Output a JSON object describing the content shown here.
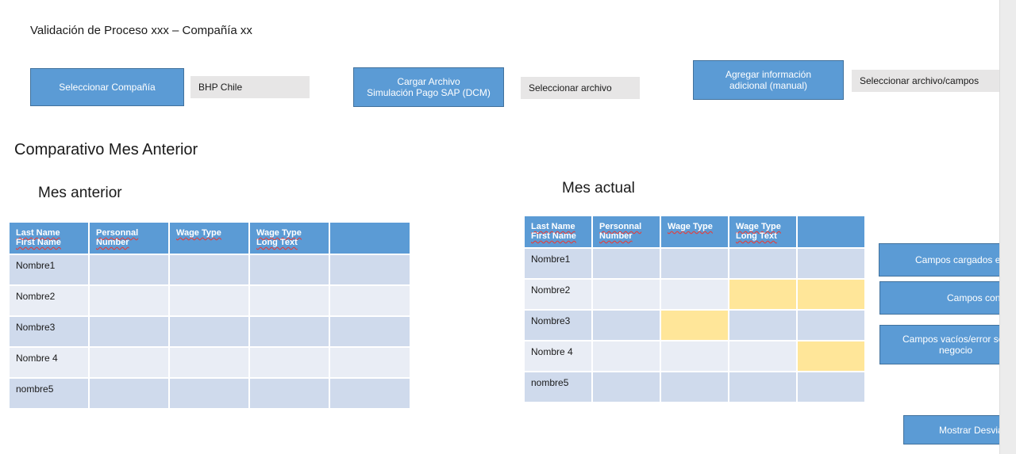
{
  "page": {
    "title": "Validación de Proceso xxx – Compañía xx"
  },
  "controls": {
    "select_company_label": "Seleccionar Compañía",
    "company_value": "BHP Chile",
    "load_file_label": "Cargar Archivo\nSimulación Pago SAP (DCM)",
    "file_value": "Seleccionar archivo",
    "add_info_label": "Agregar información\nadicional (manual)",
    "add_info_value": "Seleccionar archivo/campos"
  },
  "comparison": {
    "title": "Comparativo Mes Anterior",
    "previous": {
      "title": "Mes anterior",
      "headers": [
        [
          "Last Name",
          "First Name"
        ],
        [
          "Personnal",
          "Number"
        ],
        [
          "Wage Type"
        ],
        [
          "Wage Type",
          "Long Text"
        ],
        [
          ""
        ]
      ],
      "rows": [
        [
          "Nombre1",
          "",
          "",
          "",
          ""
        ],
        [
          "Nombre2",
          "",
          "",
          "",
          ""
        ],
        [
          "Nombre3",
          "",
          "",
          "",
          ""
        ],
        [
          "Nombre 4",
          "",
          "",
          "",
          ""
        ],
        [
          "nombre5",
          "",
          "",
          "",
          ""
        ]
      ]
    },
    "current": {
      "title": "Mes actual",
      "headers": [
        [
          "Last Name",
          "First Name"
        ],
        [
          "Personnal",
          "Number"
        ],
        [
          "Wage Type"
        ],
        [
          "Wage Type",
          "Long Text"
        ],
        [
          ""
        ]
      ],
      "rows": [
        [
          "Nombre1",
          "",
          "",
          "",
          ""
        ],
        [
          "Nombre2",
          "",
          "",
          "",
          ""
        ],
        [
          "Nombre3",
          "",
          "",
          "",
          ""
        ],
        [
          "Nombre 4",
          "",
          "",
          "",
          ""
        ],
        [
          "nombre5",
          "",
          "",
          "",
          ""
        ]
      ],
      "highlights": [
        [
          1,
          3
        ],
        [
          1,
          4
        ],
        [
          2,
          2
        ],
        [
          3,
          4
        ]
      ]
    }
  },
  "legend": {
    "loaded_ok": "Campos cargados exit",
    "with_error": "Campos con er",
    "empty_error": "Campos vacíos/error seg\nnegocio"
  },
  "actions": {
    "show_deviations": "Mostrar Desviac"
  },
  "colors": {
    "accent": "#5b9bd5",
    "row_odd": "#cfdaec",
    "row_even": "#e9edf5",
    "highlight": "#ffe699"
  }
}
